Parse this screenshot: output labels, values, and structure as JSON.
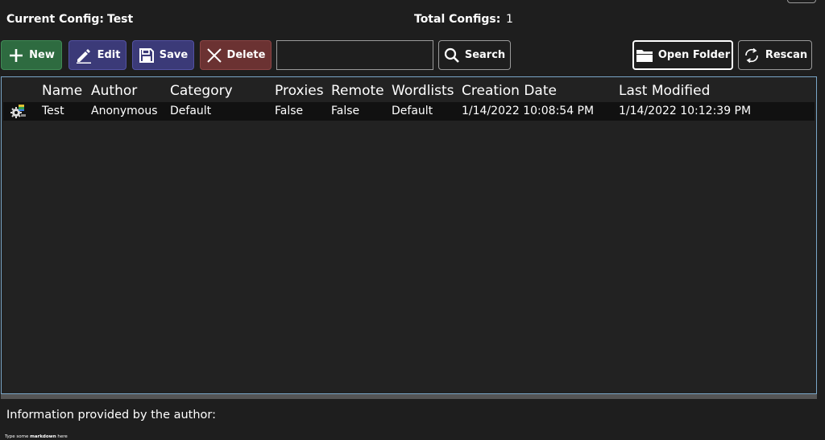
{
  "header": {
    "current_config_label": "Current Config:",
    "current_config_value": "Test",
    "total_configs_label": "Total Configs:",
    "total_configs_value": "1"
  },
  "toolbar": {
    "new_label": "New",
    "edit_label": "Edit",
    "save_label": "Save",
    "delete_label": "Delete",
    "search_value": "",
    "search_label": "Search",
    "open_folder_label": "Open Folder",
    "rescan_label": "Rescan"
  },
  "colors": {
    "new_button": "#2e6b40",
    "edit_button": "#3b3a78",
    "save_button": "#3b3a78",
    "delete_button": "#6b3232",
    "grid_border": "#7aa6c8",
    "background": "#1e1e1e"
  },
  "grid": {
    "columns": [
      "Name",
      "Author",
      "Category",
      "Proxies",
      "Remote",
      "Wordlists",
      "Creation Date",
      "Last Modified"
    ],
    "rows": [
      {
        "icon": "config-gear-icon",
        "name": "Test",
        "author": "Anonymous",
        "category": "Default",
        "proxies": "False",
        "remote": "False",
        "wordlists": "Default",
        "creation_date": "1/14/2022 10:08:54 PM",
        "last_modified": "1/14/2022 10:12:39 PM"
      }
    ]
  },
  "info": {
    "label": "Information provided by the author:",
    "markdown_hint_prefix": "Type some ",
    "markdown_hint_bold": "markdown",
    "markdown_hint_suffix": " here"
  }
}
